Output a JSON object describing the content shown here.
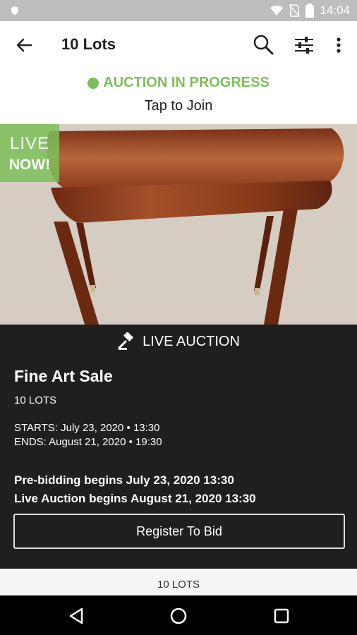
{
  "status_bar": {
    "time": "14:04"
  },
  "app_bar": {
    "title": "10 Lots"
  },
  "auction_status": {
    "label": "AUCTION IN PROGRESS",
    "action": "Tap to Join",
    "accent_color": "#7cbf5a"
  },
  "badge": {
    "line1": "LIVE",
    "line2": "NOW!"
  },
  "panel": {
    "type_label": "LIVE AUCTION",
    "title": "Fine Art Sale",
    "lots": "10 LOTS",
    "starts": "STARTS: July 23, 2020 • 13:30",
    "ends": "ENDS: August 21, 2020 • 19:30",
    "prebid": "Pre-bidding begins July 23, 2020  13:30",
    "live_begins": "Live Auction begins August 21, 2020  13:30",
    "register_label": "Register To Bid"
  },
  "lots_strip": {
    "label": "10 LOTS"
  },
  "icons": {
    "back": "arrow-left-icon",
    "search": "search-icon",
    "filter": "sliders-icon",
    "more": "more-vert-icon",
    "gavel": "gavel-icon"
  }
}
